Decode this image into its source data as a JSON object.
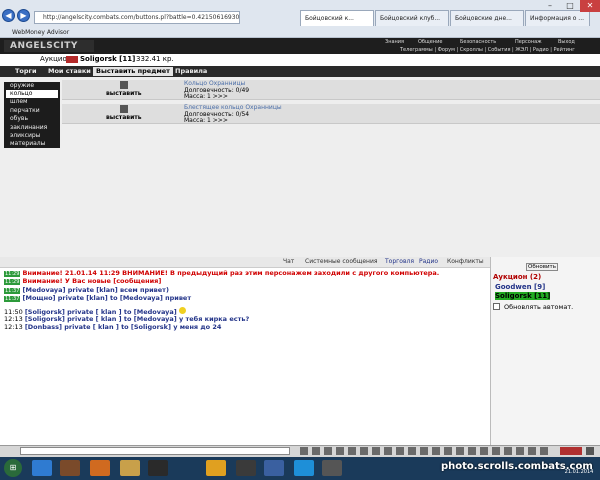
{
  "browser": {
    "address": "http://angelscity.combats.com/buttons.pl?battle=0.421506169306117",
    "tabs": [
      "Бойцовский к...",
      "Бойцовский клуб...",
      "Бойцовские дне...",
      "Информация о ..."
    ],
    "favorites": "WebMoney Advisor"
  },
  "game": {
    "logo": "ANGELSCITY",
    "top_menu": [
      "Знания",
      "Общение",
      "Безопасность",
      "Персонаж",
      "Выход"
    ],
    "second_menu": "Телеграммы | Форум | Скроллы | События | ЖЭЛ | Радио | Рейтинг",
    "location": "Аукцион",
    "player_name": "Soligorsk [11]",
    "money": "332.41 кр.",
    "tabs": [
      "Торги",
      "Мои ставки",
      "Выставить предмет",
      "Правила"
    ],
    "categories": [
      "оружие",
      "кольцо",
      "шлем",
      "перчатки",
      "обувь",
      "заклинания",
      "эликсиры",
      "материалы"
    ],
    "items": [
      {
        "button": "выставить",
        "name": "Кольцо Охранницы",
        "durability": "Долговечность: 0/49",
        "mass": "Масса: 1 >>>"
      },
      {
        "button": "выставить",
        "name": "Блестящее кольцо Охранницы",
        "durability": "Долговечность: 0/54",
        "mass": "Масса: 1 >>>"
      }
    ]
  },
  "chat": {
    "tabs": [
      "Чат",
      "Системные сообщения",
      "Торговля",
      "Радио",
      "Конфликты"
    ],
    "lines": [
      {
        "time": "11:29",
        "text": "Внимание! 21.01.14 11:29 ВНИМАНИЕ! В предыдущий раз этим персонажем заходили с другого компьютера."
      },
      {
        "time": "11:29",
        "text": "Внимание! У Вас новые [сообщения]"
      },
      {
        "time": "11:37",
        "text": "[Medovaya] private [klan] всем привет)"
      },
      {
        "time": "11:37",
        "text": "[Мощно] private [klan] to [Medovaya] привет"
      },
      {
        "time": "11:50",
        "text": "[Soligorsk] private [ klan ] to [Medovaya]"
      },
      {
        "time": "12:13",
        "text": "[Soligorsk] private [ klan ] to [Medovaya] у тебя кирка есть?"
      },
      {
        "time": "12:13",
        "text": "[Donbass] private [ klan ] to [Soligorsk] у меня до 24"
      }
    ]
  },
  "right_panel": {
    "refresh_label": "Обновить",
    "title": "Аукцион (2)",
    "players": [
      "Goodwen [9]",
      "Soligorsk [11]"
    ],
    "auto_refresh": "Обновлять автомат."
  },
  "taskbar": {
    "watermark": "photo.scrolls.combats.com",
    "date": "21.01.2014"
  },
  "colors": {
    "system_red": "#d00000",
    "game_dark": "#1e1e1e",
    "time_green": "#2c9a3a"
  }
}
